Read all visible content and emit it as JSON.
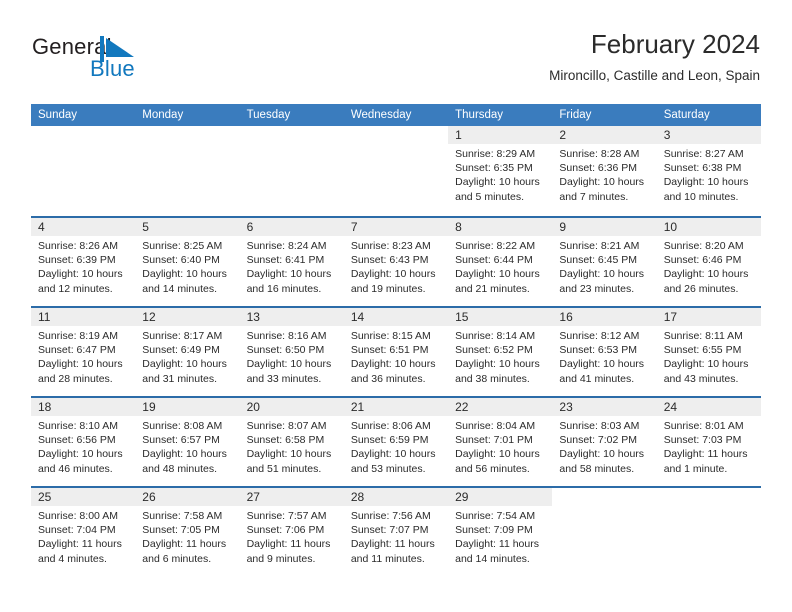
{
  "brand": {
    "name_part1": "General",
    "name_part2": "Blue",
    "mark": "triangle-flag-mark"
  },
  "header": {
    "title": "February 2024",
    "subtitle": "Mironcillo, Castille and Leon, Spain"
  },
  "colors": {
    "header_blue": "#3a7cbe",
    "row_rule_blue": "#2c6ca8",
    "daynum_band": "#eeeeee",
    "brand_blue": "#1278be",
    "text": "#2b2b2b"
  },
  "weekdays": [
    "Sunday",
    "Monday",
    "Tuesday",
    "Wednesday",
    "Thursday",
    "Friday",
    "Saturday"
  ],
  "labels": {
    "sunrise": "Sunrise:",
    "sunset": "Sunset:",
    "daylight": "Daylight:"
  },
  "weeks": [
    [
      {
        "empty": true
      },
      {
        "empty": true
      },
      {
        "empty": true
      },
      {
        "empty": true
      },
      {
        "day": "1",
        "sunrise": "Sunrise: 8:29 AM",
        "sunset": "Sunset: 6:35 PM",
        "daylight_l1": "Daylight: 10 hours",
        "daylight_l2": "and 5 minutes."
      },
      {
        "day": "2",
        "sunrise": "Sunrise: 8:28 AM",
        "sunset": "Sunset: 6:36 PM",
        "daylight_l1": "Daylight: 10 hours",
        "daylight_l2": "and 7 minutes."
      },
      {
        "day": "3",
        "sunrise": "Sunrise: 8:27 AM",
        "sunset": "Sunset: 6:38 PM",
        "daylight_l1": "Daylight: 10 hours",
        "daylight_l2": "and 10 minutes."
      }
    ],
    [
      {
        "day": "4",
        "sunrise": "Sunrise: 8:26 AM",
        "sunset": "Sunset: 6:39 PM",
        "daylight_l1": "Daylight: 10 hours",
        "daylight_l2": "and 12 minutes."
      },
      {
        "day": "5",
        "sunrise": "Sunrise: 8:25 AM",
        "sunset": "Sunset: 6:40 PM",
        "daylight_l1": "Daylight: 10 hours",
        "daylight_l2": "and 14 minutes."
      },
      {
        "day": "6",
        "sunrise": "Sunrise: 8:24 AM",
        "sunset": "Sunset: 6:41 PM",
        "daylight_l1": "Daylight: 10 hours",
        "daylight_l2": "and 16 minutes."
      },
      {
        "day": "7",
        "sunrise": "Sunrise: 8:23 AM",
        "sunset": "Sunset: 6:43 PM",
        "daylight_l1": "Daylight: 10 hours",
        "daylight_l2": "and 19 minutes."
      },
      {
        "day": "8",
        "sunrise": "Sunrise: 8:22 AM",
        "sunset": "Sunset: 6:44 PM",
        "daylight_l1": "Daylight: 10 hours",
        "daylight_l2": "and 21 minutes."
      },
      {
        "day": "9",
        "sunrise": "Sunrise: 8:21 AM",
        "sunset": "Sunset: 6:45 PM",
        "daylight_l1": "Daylight: 10 hours",
        "daylight_l2": "and 23 minutes."
      },
      {
        "day": "10",
        "sunrise": "Sunrise: 8:20 AM",
        "sunset": "Sunset: 6:46 PM",
        "daylight_l1": "Daylight: 10 hours",
        "daylight_l2": "and 26 minutes."
      }
    ],
    [
      {
        "day": "11",
        "sunrise": "Sunrise: 8:19 AM",
        "sunset": "Sunset: 6:47 PM",
        "daylight_l1": "Daylight: 10 hours",
        "daylight_l2": "and 28 minutes."
      },
      {
        "day": "12",
        "sunrise": "Sunrise: 8:17 AM",
        "sunset": "Sunset: 6:49 PM",
        "daylight_l1": "Daylight: 10 hours",
        "daylight_l2": "and 31 minutes."
      },
      {
        "day": "13",
        "sunrise": "Sunrise: 8:16 AM",
        "sunset": "Sunset: 6:50 PM",
        "daylight_l1": "Daylight: 10 hours",
        "daylight_l2": "and 33 minutes."
      },
      {
        "day": "14",
        "sunrise": "Sunrise: 8:15 AM",
        "sunset": "Sunset: 6:51 PM",
        "daylight_l1": "Daylight: 10 hours",
        "daylight_l2": "and 36 minutes."
      },
      {
        "day": "15",
        "sunrise": "Sunrise: 8:14 AM",
        "sunset": "Sunset: 6:52 PM",
        "daylight_l1": "Daylight: 10 hours",
        "daylight_l2": "and 38 minutes."
      },
      {
        "day": "16",
        "sunrise": "Sunrise: 8:12 AM",
        "sunset": "Sunset: 6:53 PM",
        "daylight_l1": "Daylight: 10 hours",
        "daylight_l2": "and 41 minutes."
      },
      {
        "day": "17",
        "sunrise": "Sunrise: 8:11 AM",
        "sunset": "Sunset: 6:55 PM",
        "daylight_l1": "Daylight: 10 hours",
        "daylight_l2": "and 43 minutes."
      }
    ],
    [
      {
        "day": "18",
        "sunrise": "Sunrise: 8:10 AM",
        "sunset": "Sunset: 6:56 PM",
        "daylight_l1": "Daylight: 10 hours",
        "daylight_l2": "and 46 minutes."
      },
      {
        "day": "19",
        "sunrise": "Sunrise: 8:08 AM",
        "sunset": "Sunset: 6:57 PM",
        "daylight_l1": "Daylight: 10 hours",
        "daylight_l2": "and 48 minutes."
      },
      {
        "day": "20",
        "sunrise": "Sunrise: 8:07 AM",
        "sunset": "Sunset: 6:58 PM",
        "daylight_l1": "Daylight: 10 hours",
        "daylight_l2": "and 51 minutes."
      },
      {
        "day": "21",
        "sunrise": "Sunrise: 8:06 AM",
        "sunset": "Sunset: 6:59 PM",
        "daylight_l1": "Daylight: 10 hours",
        "daylight_l2": "and 53 minutes."
      },
      {
        "day": "22",
        "sunrise": "Sunrise: 8:04 AM",
        "sunset": "Sunset: 7:01 PM",
        "daylight_l1": "Daylight: 10 hours",
        "daylight_l2": "and 56 minutes."
      },
      {
        "day": "23",
        "sunrise": "Sunrise: 8:03 AM",
        "sunset": "Sunset: 7:02 PM",
        "daylight_l1": "Daylight: 10 hours",
        "daylight_l2": "and 58 minutes."
      },
      {
        "day": "24",
        "sunrise": "Sunrise: 8:01 AM",
        "sunset": "Sunset: 7:03 PM",
        "daylight_l1": "Daylight: 11 hours",
        "daylight_l2": "and 1 minute."
      }
    ],
    [
      {
        "day": "25",
        "sunrise": "Sunrise: 8:00 AM",
        "sunset": "Sunset: 7:04 PM",
        "daylight_l1": "Daylight: 11 hours",
        "daylight_l2": "and 4 minutes."
      },
      {
        "day": "26",
        "sunrise": "Sunrise: 7:58 AM",
        "sunset": "Sunset: 7:05 PM",
        "daylight_l1": "Daylight: 11 hours",
        "daylight_l2": "and 6 minutes."
      },
      {
        "day": "27",
        "sunrise": "Sunrise: 7:57 AM",
        "sunset": "Sunset: 7:06 PM",
        "daylight_l1": "Daylight: 11 hours",
        "daylight_l2": "and 9 minutes."
      },
      {
        "day": "28",
        "sunrise": "Sunrise: 7:56 AM",
        "sunset": "Sunset: 7:07 PM",
        "daylight_l1": "Daylight: 11 hours",
        "daylight_l2": "and 11 minutes."
      },
      {
        "day": "29",
        "sunrise": "Sunrise: 7:54 AM",
        "sunset": "Sunset: 7:09 PM",
        "daylight_l1": "Daylight: 11 hours",
        "daylight_l2": "and 14 minutes."
      },
      {
        "empty": true
      },
      {
        "empty": true
      }
    ]
  ]
}
